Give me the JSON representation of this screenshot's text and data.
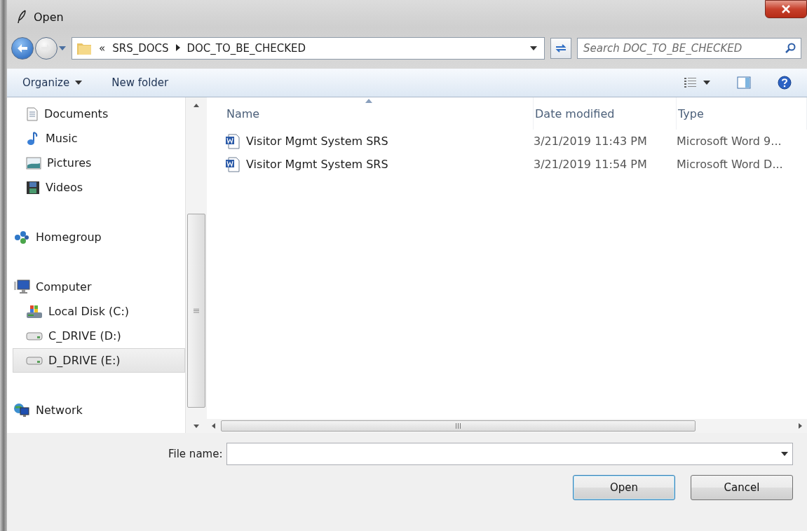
{
  "window": {
    "title": "Open"
  },
  "address": {
    "path": [
      {
        "label": "SRS_DOCS"
      },
      {
        "label": "DOC_TO_BE_CHECKED"
      }
    ],
    "overflow": "«"
  },
  "search": {
    "placeholder": "Search DOC_TO_BE_CHECKED"
  },
  "toolbar": {
    "buttons": [
      {
        "label": "Organize",
        "dropdown": true
      },
      {
        "label": "New folder",
        "dropdown": false
      }
    ]
  },
  "sidebar": {
    "sections": [
      {
        "items": [
          {
            "label": "Documents",
            "kind": "documents",
            "selected": false
          },
          {
            "label": "Music",
            "kind": "music",
            "selected": false
          },
          {
            "label": "Pictures",
            "kind": "pictures",
            "selected": false
          },
          {
            "label": "Videos",
            "kind": "videos",
            "selected": false
          }
        ]
      },
      {
        "items": [
          {
            "label": "Homegroup",
            "kind": "homegroup",
            "selected": false
          }
        ]
      },
      {
        "items": [
          {
            "label": "Computer",
            "kind": "computer",
            "selected": false,
            "children": [
              {
                "label": "Local Disk (C:)",
                "kind": "system-drive",
                "selected": false
              },
              {
                "label": "C_DRIVE (D:)",
                "kind": "drive",
                "selected": false
              },
              {
                "label": "D_DRIVE (E:)",
                "kind": "drive",
                "selected": true
              }
            ]
          }
        ]
      },
      {
        "items": [
          {
            "label": "Network",
            "kind": "network",
            "selected": false
          }
        ]
      }
    ]
  },
  "table": {
    "columns": [
      {
        "label": "Name",
        "sorted": true
      },
      {
        "label": "Date modified",
        "sorted": false
      },
      {
        "label": "Type",
        "sorted": false
      }
    ],
    "rows": [
      {
        "name": "Visitor Mgmt System SRS",
        "date": "3/21/2019 11:43 PM",
        "type": "Microsoft Word 9..."
      },
      {
        "name": "Visitor Mgmt System SRS",
        "date": "3/21/2019 11:54 PM",
        "type": "Microsoft Word D..."
      }
    ]
  },
  "file_name": {
    "label": "File name:"
  },
  "buttons": [
    {
      "label": "Open",
      "default": true
    },
    {
      "label": "Cancel",
      "default": false
    }
  ]
}
